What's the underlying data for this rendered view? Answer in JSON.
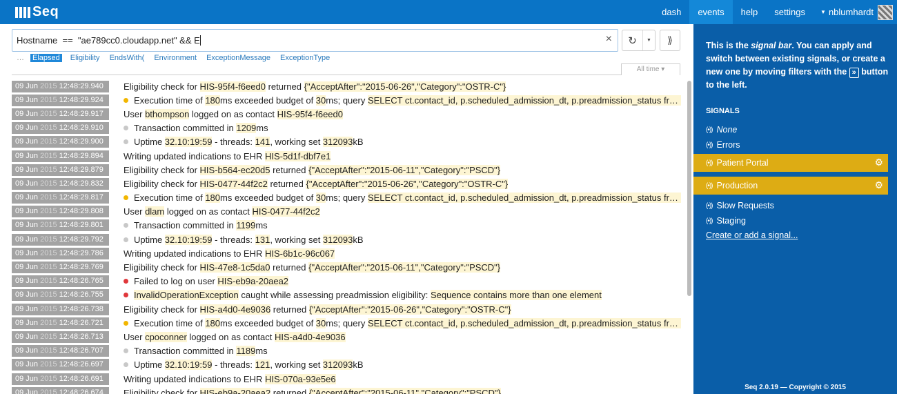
{
  "app": {
    "name": "Seq"
  },
  "nav": {
    "items": [
      {
        "label": "dash"
      },
      {
        "label": "events",
        "active": true
      },
      {
        "label": "help"
      },
      {
        "label": "settings"
      }
    ],
    "user": "nblumhardt"
  },
  "query": {
    "value": "Hostname  ==  \"ae789cc0.cloudapp.net\" && E"
  },
  "suggestions": {
    "dots": "…",
    "items": [
      "Elapsed",
      "Eligibility",
      "EndsWith(",
      "Environment",
      "ExceptionMessage",
      "ExceptionType"
    ],
    "selected": 0
  },
  "range": {
    "label": "All time"
  },
  "events": [
    {
      "date": "09 Jun",
      "year": "2015",
      "time": "12:48:29.940",
      "level": "",
      "parts": [
        [
          "Eligibility check for ",
          0
        ],
        [
          "HIS-95f4-f6eed0",
          1
        ],
        [
          " returned ",
          0
        ],
        [
          "{\"AcceptAfter\":\"2015-06-26\",\"Category\":\"OSTR-C\"}",
          1
        ]
      ]
    },
    {
      "date": "09 Jun",
      "year": "2015",
      "time": "12:48:29.924",
      "level": "warn",
      "parts": [
        [
          "Execution time of ",
          0
        ],
        [
          "180",
          1
        ],
        [
          "ms exceeded budget of ",
          0
        ],
        [
          "30",
          1
        ],
        [
          "ms; query ",
          0
        ],
        [
          "SELECT ct.contact_id, p.scheduled_admission_dt, p.preadmission_status fro...",
          1
        ]
      ]
    },
    {
      "date": "09 Jun",
      "year": "2015",
      "time": "12:48:29.917",
      "level": "",
      "parts": [
        [
          "User ",
          0
        ],
        [
          "bthompson",
          1
        ],
        [
          " logged on as contact ",
          0
        ],
        [
          "HIS-95f4-f6eed0",
          1
        ]
      ]
    },
    {
      "date": "09 Jun",
      "year": "2015",
      "time": "12:48:29.910",
      "level": "info",
      "parts": [
        [
          "Transaction committed in ",
          0
        ],
        [
          "1209",
          1
        ],
        [
          "ms",
          0
        ]
      ]
    },
    {
      "date": "09 Jun",
      "year": "2015",
      "time": "12:48:29.900",
      "level": "info",
      "parts": [
        [
          "Uptime ",
          0
        ],
        [
          "32.10:19:59",
          1
        ],
        [
          " - threads: ",
          0
        ],
        [
          "141",
          1
        ],
        [
          ", working set ",
          0
        ],
        [
          "312093",
          1
        ],
        [
          "kB",
          0
        ]
      ]
    },
    {
      "date": "09 Jun",
      "year": "2015",
      "time": "12:48:29.894",
      "level": "",
      "parts": [
        [
          "Writing updated indications to EHR ",
          0
        ],
        [
          "HIS-5d1f-dbf7e1",
          1
        ]
      ]
    },
    {
      "date": "09 Jun",
      "year": "2015",
      "time": "12:48:29.879",
      "level": "",
      "parts": [
        [
          "Eligibility check for ",
          0
        ],
        [
          "HIS-b564-ec20d5",
          1
        ],
        [
          " returned ",
          0
        ],
        [
          "{\"AcceptAfter\":\"2015-06-11\",\"Category\":\"PSCD\"}",
          1
        ]
      ]
    },
    {
      "date": "09 Jun",
      "year": "2015",
      "time": "12:48:29.832",
      "level": "",
      "parts": [
        [
          "Eligibility check for ",
          0
        ],
        [
          "HIS-0477-44f2c2",
          1
        ],
        [
          " returned ",
          0
        ],
        [
          "{\"AcceptAfter\":\"2015-06-26\",\"Category\":\"OSTR-C\"}",
          1
        ]
      ]
    },
    {
      "date": "09 Jun",
      "year": "2015",
      "time": "12:48:29.817",
      "level": "warn",
      "parts": [
        [
          "Execution time of ",
          0
        ],
        [
          "180",
          1
        ],
        [
          "ms exceeded budget of ",
          0
        ],
        [
          "30",
          1
        ],
        [
          "ms; query ",
          0
        ],
        [
          "SELECT ct.contact_id, p.scheduled_admission_dt, p.preadmission_status fro...",
          1
        ]
      ]
    },
    {
      "date": "09 Jun",
      "year": "2015",
      "time": "12:48:29.808",
      "level": "",
      "parts": [
        [
          "User ",
          0
        ],
        [
          "dlam",
          1
        ],
        [
          " logged on as contact ",
          0
        ],
        [
          "HIS-0477-44f2c2",
          1
        ]
      ]
    },
    {
      "date": "09 Jun",
      "year": "2015",
      "time": "12:48:29.801",
      "level": "info",
      "parts": [
        [
          "Transaction committed in ",
          0
        ],
        [
          "1199",
          1
        ],
        [
          "ms",
          0
        ]
      ]
    },
    {
      "date": "09 Jun",
      "year": "2015",
      "time": "12:48:29.792",
      "level": "info",
      "parts": [
        [
          "Uptime ",
          0
        ],
        [
          "32.10:19:59",
          1
        ],
        [
          " - threads: ",
          0
        ],
        [
          "131",
          1
        ],
        [
          ", working set ",
          0
        ],
        [
          "312093",
          1
        ],
        [
          "kB",
          0
        ]
      ]
    },
    {
      "date": "09 Jun",
      "year": "2015",
      "time": "12:48:29.786",
      "level": "",
      "parts": [
        [
          "Writing updated indications to EHR ",
          0
        ],
        [
          "HIS-6b1c-96c067",
          1
        ]
      ]
    },
    {
      "date": "09 Jun",
      "year": "2015",
      "time": "12:48:29.769",
      "level": "",
      "parts": [
        [
          "Eligibility check for ",
          0
        ],
        [
          "HIS-47e8-1c5da0",
          1
        ],
        [
          " returned ",
          0
        ],
        [
          "{\"AcceptAfter\":\"2015-06-11\",\"Category\":\"PSCD\"}",
          1
        ]
      ]
    },
    {
      "date": "09 Jun",
      "year": "2015",
      "time": "12:48:26.765",
      "level": "err",
      "parts": [
        [
          "Failed to log on user ",
          0
        ],
        [
          "HIS-eb9a-20aea2",
          1
        ]
      ]
    },
    {
      "date": "09 Jun",
      "year": "2015",
      "time": "12:48:26.755",
      "level": "err",
      "parts": [
        [
          "InvalidOperationException",
          1
        ],
        [
          " caught while assessing preadmission eligibility: ",
          0
        ],
        [
          "Sequence contains more than one element",
          1
        ]
      ]
    },
    {
      "date": "09 Jun",
      "year": "2015",
      "time": "12:48:26.738",
      "level": "",
      "parts": [
        [
          "Eligibility check for ",
          0
        ],
        [
          "HIS-a4d0-4e9036",
          1
        ],
        [
          " returned ",
          0
        ],
        [
          "{\"AcceptAfter\":\"2015-06-26\",\"Category\":\"OSTR-C\"}",
          1
        ]
      ]
    },
    {
      "date": "09 Jun",
      "year": "2015",
      "time": "12:48:26.721",
      "level": "warn",
      "parts": [
        [
          "Execution time of ",
          0
        ],
        [
          "180",
          1
        ],
        [
          "ms exceeded budget of ",
          0
        ],
        [
          "30",
          1
        ],
        [
          "ms; query ",
          0
        ],
        [
          "SELECT ct.contact_id, p.scheduled_admission_dt, p.preadmission_status fro...",
          1
        ]
      ]
    },
    {
      "date": "09 Jun",
      "year": "2015",
      "time": "12:48:26.713",
      "level": "",
      "parts": [
        [
          "User ",
          0
        ],
        [
          "cpoconner",
          1
        ],
        [
          " logged on as contact ",
          0
        ],
        [
          "HIS-a4d0-4e9036",
          1
        ]
      ]
    },
    {
      "date": "09 Jun",
      "year": "2015",
      "time": "12:48:26.707",
      "level": "info",
      "parts": [
        [
          "Transaction committed in ",
          0
        ],
        [
          "1189",
          1
        ],
        [
          "ms",
          0
        ]
      ]
    },
    {
      "date": "09 Jun",
      "year": "2015",
      "time": "12:48:26.697",
      "level": "info",
      "parts": [
        [
          "Uptime ",
          0
        ],
        [
          "32.10:19:59",
          1
        ],
        [
          " - threads: ",
          0
        ],
        [
          "121",
          1
        ],
        [
          ", working set ",
          0
        ],
        [
          "312093",
          1
        ],
        [
          "kB",
          0
        ]
      ]
    },
    {
      "date": "09 Jun",
      "year": "2015",
      "time": "12:48:26.691",
      "level": "",
      "parts": [
        [
          "Writing updated indications to EHR ",
          0
        ],
        [
          "HIS-070a-93e5e6",
          1
        ]
      ]
    },
    {
      "date": "09 Jun",
      "year": "2015",
      "time": "12:48:26.674",
      "level": "",
      "parts": [
        [
          "Eligibility check for ",
          0
        ],
        [
          "HIS-eb9a-20aea2",
          1
        ],
        [
          " returned ",
          0
        ],
        [
          "{\"AcceptAfter\":\"2015-06-11\",\"Category\":\"PSCD\"}",
          1
        ]
      ]
    }
  ],
  "signalbar": {
    "intro_1": "This is the ",
    "intro_em": "signal bar",
    "intro_2": ". You can apply and switch between existing signals, or create a new one by moving filters with the ",
    "intro_kbd": "»",
    "intro_3": " button to the left.",
    "heading": "SIGNALS",
    "signals": [
      {
        "label": "None",
        "italic": true
      },
      {
        "label": "Errors"
      },
      {
        "label": "Patient Portal",
        "active": true
      },
      {
        "label": "Production",
        "active": true
      },
      {
        "label": "Slow Requests"
      },
      {
        "label": "Staging"
      }
    ],
    "create": "Create or add a signal...",
    "footer": "Seq 2.0.19 — Copyright © 2015"
  },
  "colors": {
    "topbar": "#0a74c6",
    "sidebar": "#0a5ea8",
    "active_signal": "#ddac14",
    "highlight": "#fdf5d3",
    "warn": "#f2b600",
    "error": "#e0373b"
  }
}
